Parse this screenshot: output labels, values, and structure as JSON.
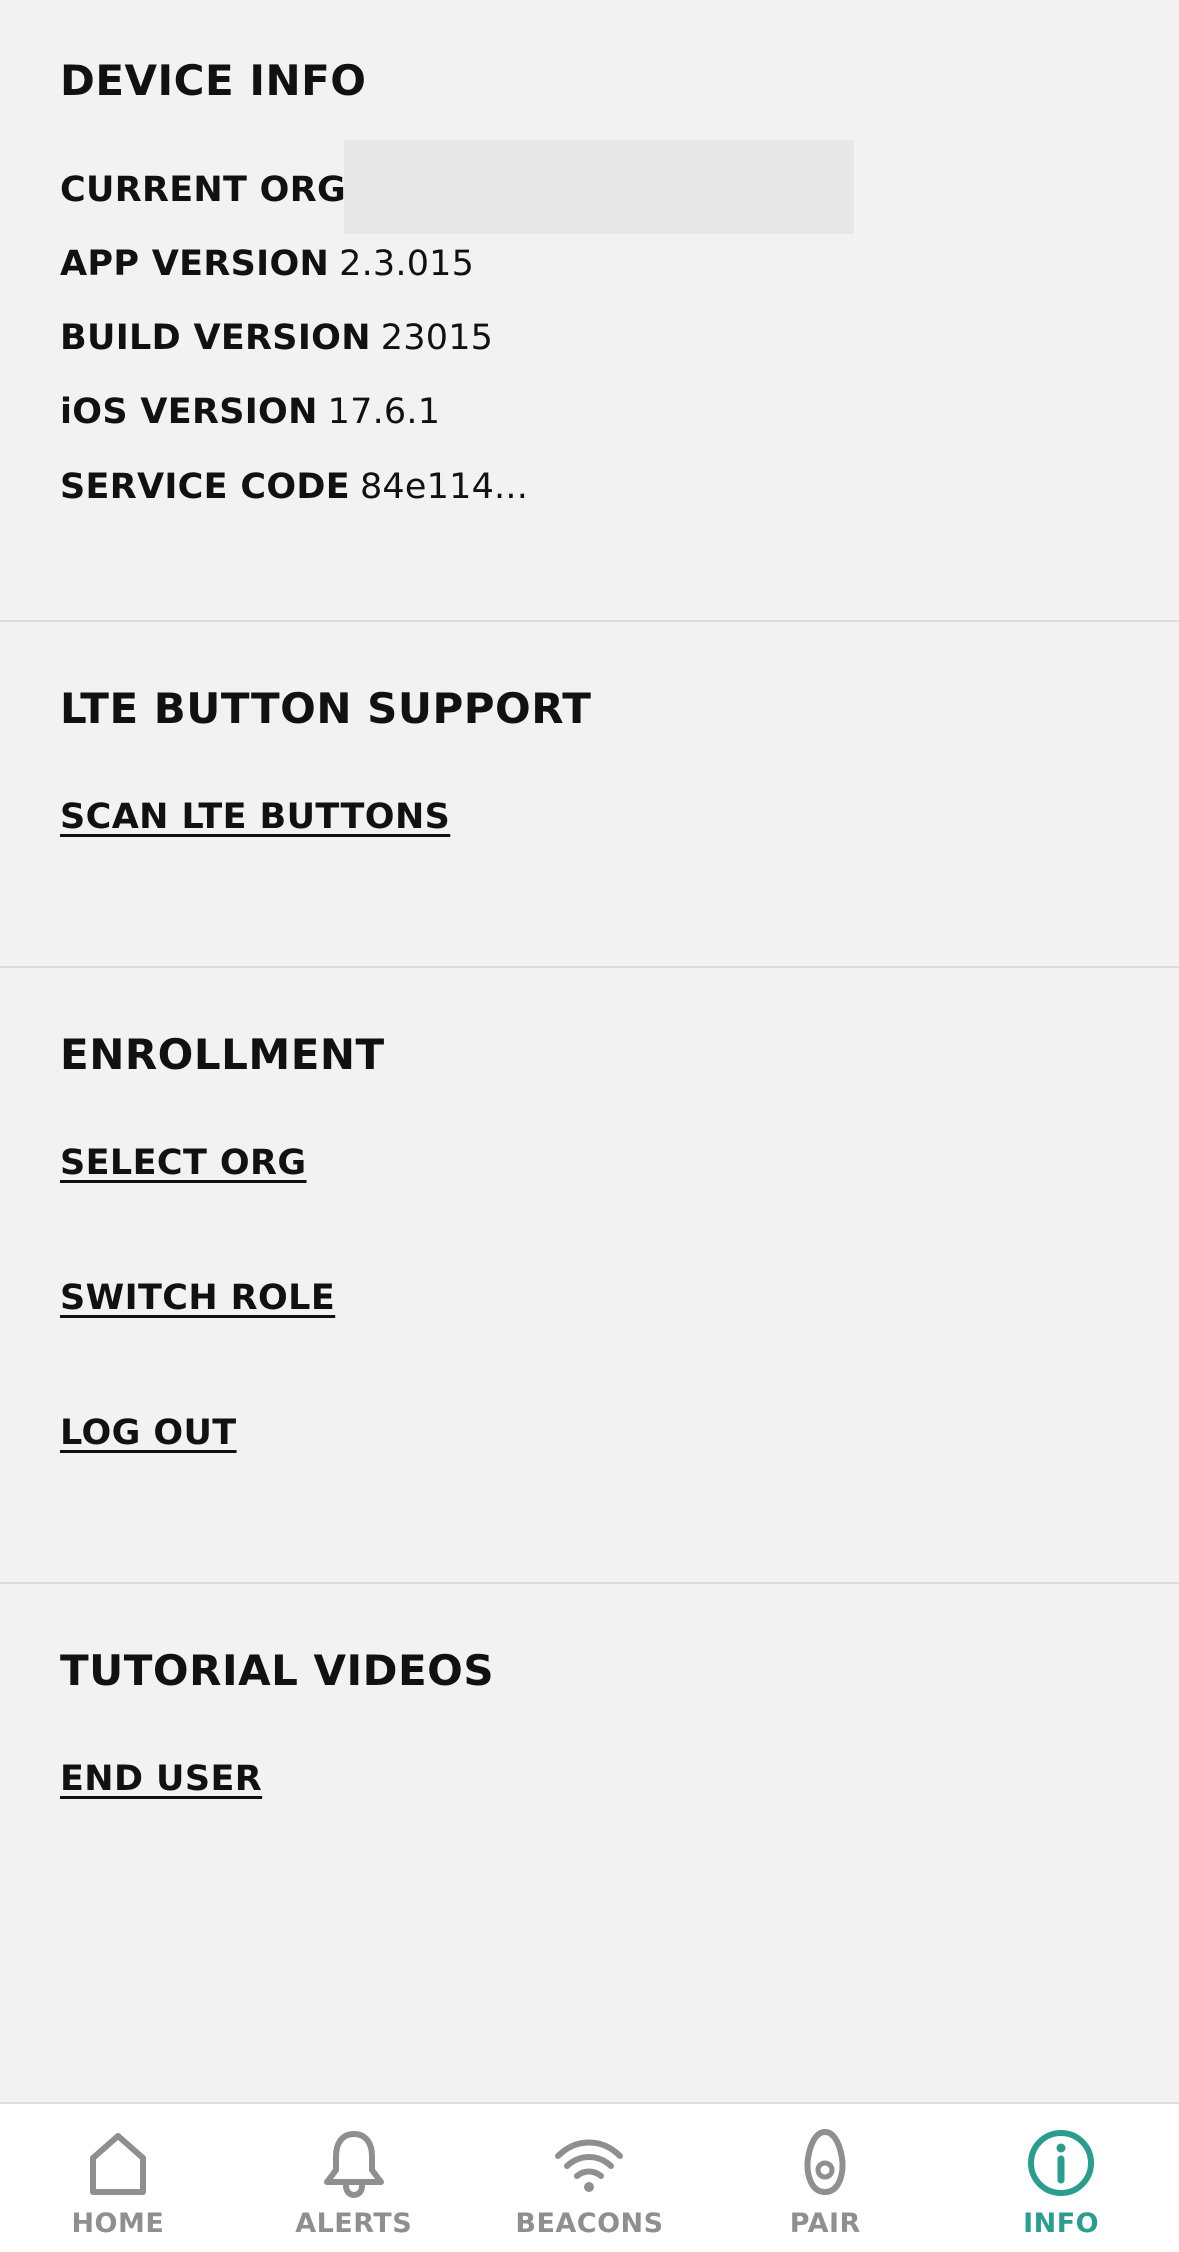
{
  "device_info": {
    "title": "DEVICE INFO",
    "rows": [
      {
        "label": "CURRENT ORG",
        "value": ""
      },
      {
        "label": "APP VERSION",
        "value": "2.3.015"
      },
      {
        "label": "BUILD VERSION",
        "value": "23015"
      },
      {
        "label": "iOS VERSION",
        "value": "17.6.1"
      },
      {
        "label": "SERVICE CODE",
        "value": "84e114..."
      }
    ]
  },
  "lte": {
    "title": "LTE BUTTON SUPPORT",
    "scan_label": "SCAN LTE BUTTONS"
  },
  "enrollment": {
    "title": "ENROLLMENT",
    "select_org": "SELECT ORG",
    "switch_role": "SWITCH ROLE",
    "log_out": "LOG OUT"
  },
  "tutorials": {
    "title": "TUTORIAL VIDEOS",
    "end_user": "END USER"
  },
  "tabbar": {
    "active": "info",
    "active_color": "#2a9d8f",
    "inactive_color": "#8f8f8f",
    "tabs": [
      {
        "id": "home",
        "label": "HOME",
        "icon": "home-icon"
      },
      {
        "id": "alerts",
        "label": "ALERTS",
        "icon": "bell-icon"
      },
      {
        "id": "beacons",
        "label": "BEACONS",
        "icon": "wifi-icon"
      },
      {
        "id": "pair",
        "label": "PAIR",
        "icon": "pair-icon"
      },
      {
        "id": "info",
        "label": "INFO",
        "icon": "info-icon"
      }
    ]
  }
}
